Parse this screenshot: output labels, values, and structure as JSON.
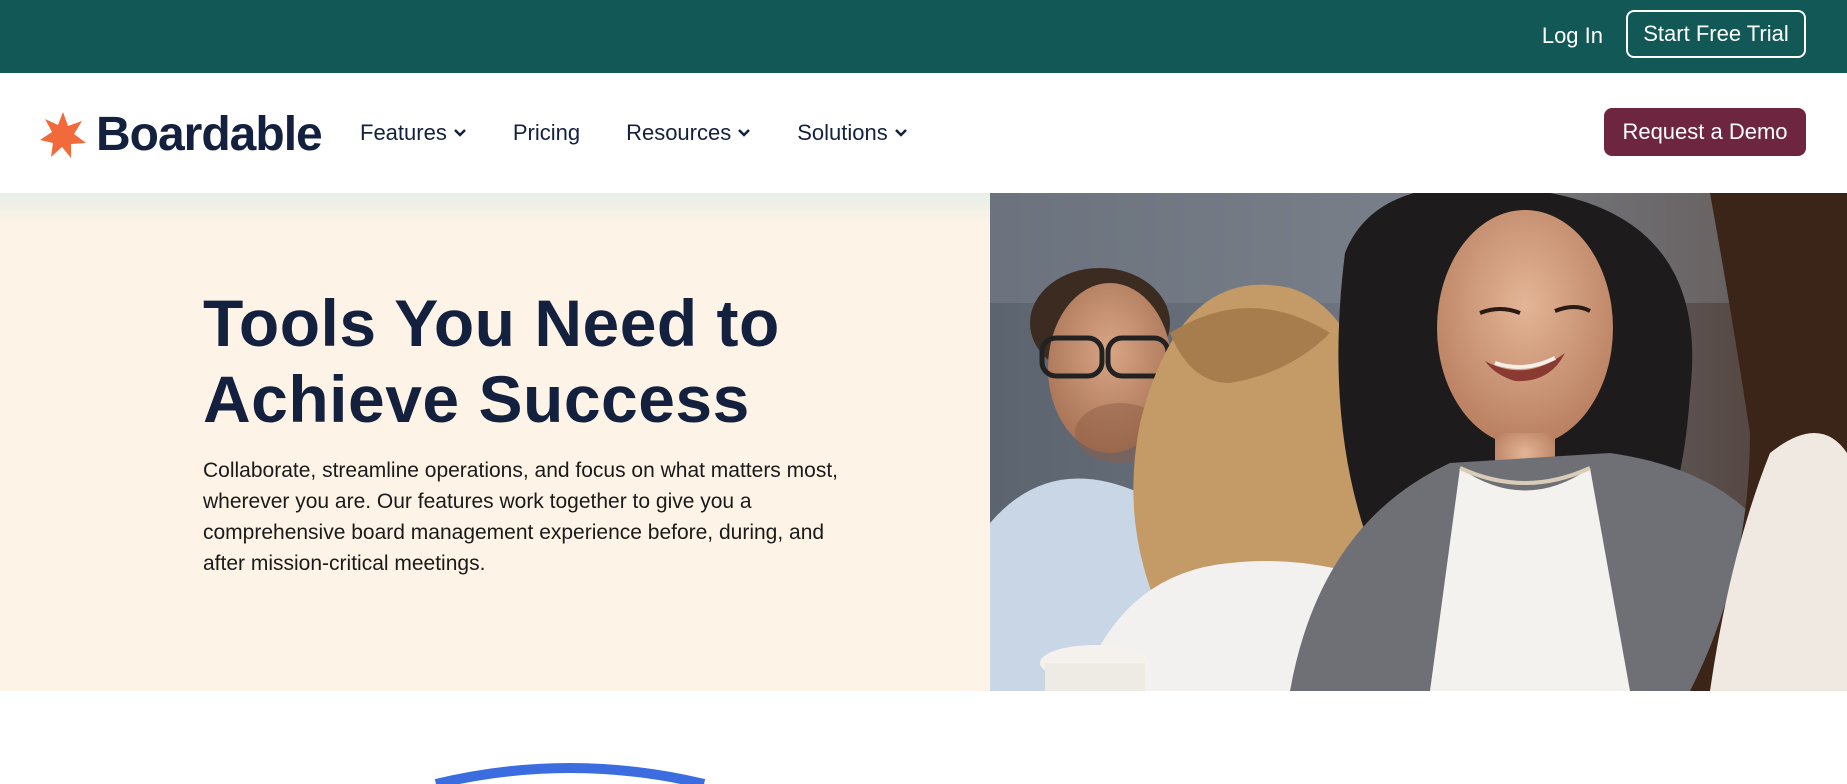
{
  "topbar": {
    "login_label": "Log In",
    "trial_label": "Start Free Trial"
  },
  "nav": {
    "logo_text": "Boardable",
    "items": [
      {
        "label": "Features",
        "has_dropdown": true
      },
      {
        "label": "Pricing",
        "has_dropdown": false
      },
      {
        "label": "Resources",
        "has_dropdown": true
      },
      {
        "label": "Solutions",
        "has_dropdown": true
      }
    ],
    "demo_label": "Request a Demo"
  },
  "hero": {
    "title": "Tools You Need to Achieve Success",
    "subtitle": "Collaborate, streamline operations, and focus on what matters most, wherever you are. Our features work together to give you a comprehensive board management experience before, during, and after mission-critical meetings."
  },
  "colors": {
    "topbar": "#115856",
    "brand_navy": "#13213f",
    "logo_orange": "#f26a3b",
    "demo_button": "#6e2640",
    "hero_background": "#fdf3e6",
    "arc_blue": "#3b6de0"
  },
  "icons": [
    "boardable-logo-icon",
    "chevron-down-icon"
  ]
}
